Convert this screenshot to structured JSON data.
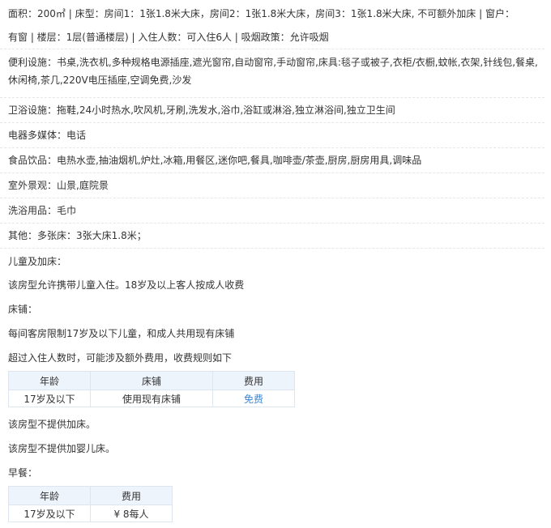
{
  "room": {
    "line1": "面积：200㎡ | 床型：房间1：1张1.8米大床，房间2：1张1.8米大床，房间3：1张1.8米大床, 不可额外加床 | 窗户：",
    "line2": "有窗 | 楼层：1层(普通楼层) | 入住人数：可入住6人 | 吸烟政策：允许吸烟"
  },
  "facilities": {
    "convenience": "便利设施：书桌,洗衣机,多种规格电源插座,遮光窗帘,自动窗帘,手动窗帘,床具:毯子或被子,衣柜/衣橱,蚊帐,衣架,针线包,餐桌,休闲椅,茶几,220V电压插座,空调免费,沙发",
    "bathroom": "卫浴设施：拖鞋,24小时热水,吹风机,牙刷,洗发水,浴巾,浴缸或淋浴,独立淋浴间,独立卫生间",
    "media": "电器多媒体：电话",
    "food": "食品饮品：电热水壶,抽油烟机,炉灶,冰箱,用餐区,迷你吧,餐具,咖啡壶/茶壶,厨房,厨房用具,调味品",
    "view": "室外景观：山景,庭院景",
    "toiletries": "洗浴用品：毛巾",
    "other": "其他：多张床：3张大床1.8米；"
  },
  "children": {
    "heading": "儿童及加床：",
    "allowed": "该房型允许携带儿童入住。18岁及以上客人按成人收费",
    "bedding_heading": "床铺：",
    "bedding_limit": "每间客房限制17岁及以下儿童，和成人共用现有床铺",
    "extra_note": "超过入住人数时，可能涉及额外费用，收费规则如下",
    "bed_table": {
      "headers": [
        "年龄",
        "床铺",
        "费用"
      ],
      "rows": [
        [
          "17岁及以下",
          "使用现有床铺",
          "免费"
        ]
      ]
    },
    "no_extra_bed": "该房型不提供加床。",
    "no_crib": "该房型不提供加婴儿床。"
  },
  "breakfast": {
    "heading": "早餐：",
    "table": {
      "headers": [
        "年龄",
        "费用"
      ],
      "rows": [
        [
          "17岁及以下",
          "¥ 8每人"
        ]
      ]
    }
  }
}
